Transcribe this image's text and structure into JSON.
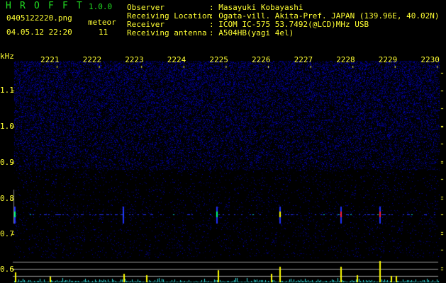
{
  "app": {
    "name_letters": [
      "H",
      "R",
      "O",
      "F",
      "F",
      "T"
    ],
    "version": "1.0.0"
  },
  "file": {
    "name": "0405122220.png",
    "datetime": "04.05.12 22:20"
  },
  "meteor": {
    "label": "meteor",
    "count": "11"
  },
  "info": [
    {
      "label": "Observer",
      "value": ": Masayuki Kobayashi"
    },
    {
      "label": "Receiving Location",
      "value": ": Ogata-vill. Akita-Pref. JAPAN (139.96E, 40.02N)"
    },
    {
      "label": "Receiver",
      "value": ": ICOM IC-575 53.7492(@LCD)MHz USB"
    },
    {
      "label": "Receiving antenna",
      "value": ": A504HB(yagi 4el)"
    }
  ],
  "axis": {
    "y_unit": "kHz",
    "y_ticks": [
      "1.1",
      "1.0",
      "0.9",
      "0.8",
      "0.7",
      "0.6"
    ],
    "x_ticks": [
      "2221",
      "2222",
      "2223",
      "2224",
      "2225",
      "2226",
      "2227",
      "2228",
      "2229",
      "2230"
    ]
  },
  "colors": {
    "text": "#ffff33",
    "logo": "#22dd22",
    "noise": "#1a1aa0",
    "bars": "#33e0e0",
    "bar_peaks": "#ffff00",
    "threshold_lines": "#a0a0a0"
  }
}
